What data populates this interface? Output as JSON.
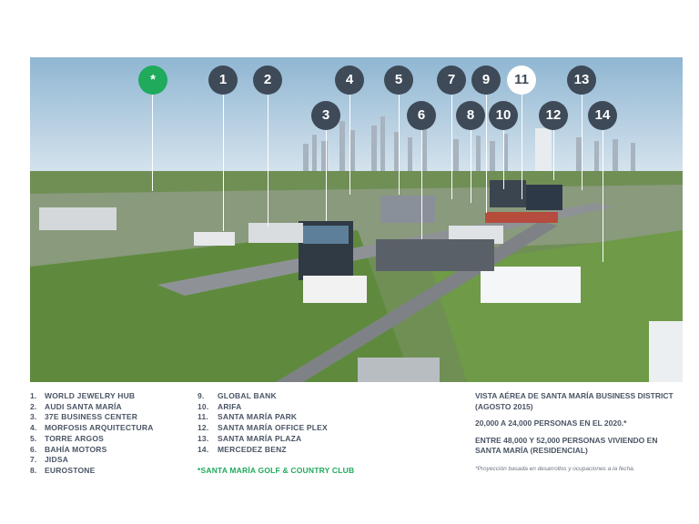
{
  "markers": [
    {
      "id": "golf",
      "label": "*",
      "style": "green"
    },
    {
      "id": "1",
      "label": "1",
      "style": "dark"
    },
    {
      "id": "2",
      "label": "2",
      "style": "dark"
    },
    {
      "id": "3",
      "label": "3",
      "style": "dark"
    },
    {
      "id": "4",
      "label": "4",
      "style": "dark"
    },
    {
      "id": "5",
      "label": "5",
      "style": "dark"
    },
    {
      "id": "6",
      "label": "6",
      "style": "dark"
    },
    {
      "id": "7",
      "label": "7",
      "style": "dark"
    },
    {
      "id": "8",
      "label": "8",
      "style": "dark"
    },
    {
      "id": "9",
      "label": "9",
      "style": "dark"
    },
    {
      "id": "10",
      "label": "10",
      "style": "dark"
    },
    {
      "id": "11",
      "label": "11",
      "style": "white"
    },
    {
      "id": "12",
      "label": "12",
      "style": "dark"
    },
    {
      "id": "13",
      "label": "13",
      "style": "dark"
    },
    {
      "id": "14",
      "label": "14",
      "style": "dark"
    }
  ],
  "legend_left": [
    {
      "num": "1.",
      "name": "WORLD JEWELRY HUB"
    },
    {
      "num": "2.",
      "name": "AUDI SANTA MARÍA"
    },
    {
      "num": "3.",
      "name": "37E BUSINESS CENTER"
    },
    {
      "num": "4.",
      "name": "MORFOSIS ARQUITECTURA"
    },
    {
      "num": "5.",
      "name": "TORRE ARGOS"
    },
    {
      "num": "6.",
      "name": "BAHÍA MOTORS"
    },
    {
      "num": "7.",
      "name": "JIDSA"
    },
    {
      "num": "8.",
      "name": "EUROSTONE"
    }
  ],
  "legend_right": [
    {
      "num": "9.",
      "name": "GLOBAL BANK"
    },
    {
      "num": "10.",
      "name": "ARIFA"
    },
    {
      "num": "11.",
      "name": "SANTA MARÍA PARK"
    },
    {
      "num": "12.",
      "name": "SANTA MARÍA OFFICE PLEX"
    },
    {
      "num": "13.",
      "name": "SANTA MARÍA PLAZA"
    },
    {
      "num": "14.",
      "name": "MERCEDEZ BENZ"
    }
  ],
  "golf_club": "*SANTA MARÍA GOLF & COUNTRY CLUB",
  "info": {
    "title": "VISTA AÉREA DE SANTA MARÍA BUSINESS DISTRICT (AGOSTO 2015)",
    "population_2020": "20,000 A 24,000 PERSONAS EN EL 2020.*",
    "residential": "ENTRE 48,000 Y 52,000 PERSONAS VIVIENDO EN SANTA MARÍA (RESIDENCIAL)",
    "footnote": "*Proyección basada en desarrollos y ocupaciones a la fecha."
  },
  "colors": {
    "marker_dark": "#3e4a58",
    "accent_green": "#1faa5c",
    "text": "#4a5565"
  }
}
